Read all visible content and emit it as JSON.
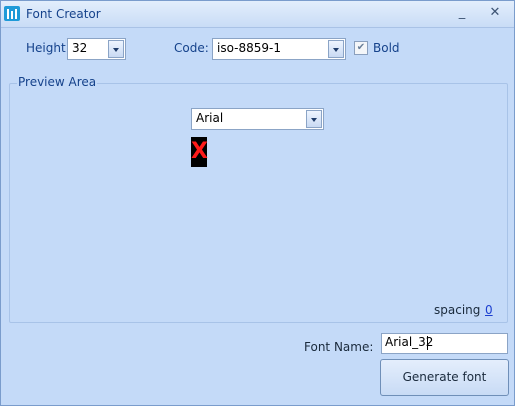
{
  "window": {
    "title": "Font Creator",
    "minimize_glyph": "_",
    "close_glyph": "✕"
  },
  "height": {
    "label": "Height:",
    "value": "32"
  },
  "code": {
    "label": "Code:",
    "value": "iso-8859-1"
  },
  "bold": {
    "label": "Bold",
    "checked": true,
    "check_glyph": "✔"
  },
  "preview_area": {
    "label": "Preview Area",
    "font_select": "Arial",
    "preview_glyph": "X",
    "spacing_label": "spacing",
    "spacing_value": "0"
  },
  "font_name": {
    "label": "Font Name:",
    "value": "Arial_32"
  },
  "generate_button": "Generate font",
  "colors": {
    "preview_glyph": "#ff1a1a",
    "preview_bg": "#000000",
    "title_text": "#15428b"
  }
}
